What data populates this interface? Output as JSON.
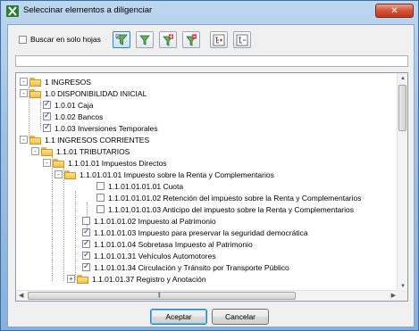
{
  "window": {
    "title": "Seleccinar elementos a diligenciar",
    "close_label": "✕"
  },
  "toolbar": {
    "only_sheets_label": "Buscar en solo hojas",
    "only_sheets_checked": false,
    "buttons": [
      {
        "name": "select-all-filter-icon"
      },
      {
        "name": "filter-icon"
      },
      {
        "name": "add-filter-icon"
      },
      {
        "name": "remove-filter-icon"
      },
      {
        "name": "expand-all-icon"
      },
      {
        "name": "collapse-all-icon"
      }
    ]
  },
  "filter": {
    "value": ""
  },
  "tree": {
    "rows": [
      {
        "label": "1 INGRESOS",
        "level": 0,
        "type": "folder",
        "expander": "-"
      },
      {
        "label": "1.0 DISPONIBILIDAD INICIAL",
        "level": 1,
        "type": "folder",
        "expander": "-"
      },
      {
        "label": "1.0.01 Caja",
        "level": 2,
        "type": "leaf",
        "checked": true
      },
      {
        "label": "1.0.02 Bancos",
        "level": 2,
        "type": "leaf",
        "checked": true
      },
      {
        "label": "1.0.03 Inversiones Temporales",
        "level": 2,
        "type": "leaf",
        "checked": true
      },
      {
        "label": "1.1 INGRESOS CORRIENTES",
        "level": 1,
        "type": "folder",
        "expander": "-"
      },
      {
        "label": "1.1.01 TRIBUTARIOS",
        "level": 2,
        "type": "folder",
        "expander": "-"
      },
      {
        "label": "1.1.01.01 Impuestos Directos",
        "level": 3,
        "type": "folder",
        "expander": "-"
      },
      {
        "label": "1.1.01.01.01 Impuesto sobre la Renta y Complementarios",
        "level": 4,
        "type": "folder",
        "expander": "-"
      },
      {
        "label": "1.1.01.01.01.01 Cuota",
        "level": 5,
        "type": "leaf",
        "checked": false
      },
      {
        "label": "1.1.01.01.01.02 Retención del impuesto sobre la Renta y Complementarios",
        "level": 5,
        "type": "leaf",
        "checked": false
      },
      {
        "label": "1.1.01.01.01.03 Anticipo del impuesto sobre la Renta y Complementarios",
        "level": 5,
        "type": "leaf",
        "checked": false
      },
      {
        "label": "1.1.01.01.02 Impuesto al Patrimonio",
        "level": 4,
        "type": "leaf",
        "checked": false
      },
      {
        "label": "1.1.01.01.03 Impuesto para preservar la seguridad democrática",
        "level": 4,
        "type": "leaf",
        "checked": true
      },
      {
        "label": "1.1.01.01.04 Sobretasa Impuesto al Patrimonio",
        "level": 4,
        "type": "leaf",
        "checked": true
      },
      {
        "label": "1.1.01.01.31 Vehículos Automotores",
        "level": 4,
        "type": "leaf",
        "checked": true
      },
      {
        "label": "1.1.01.01.34 Circulación y Tránsito por Transporte Público",
        "level": 4,
        "type": "leaf",
        "checked": true
      },
      {
        "label": "1.1.01.01.37 Registro y Anotación",
        "level": 4,
        "type": "folder",
        "expander": "+"
      }
    ]
  },
  "footer": {
    "accept_label": "Aceptar",
    "cancel_label": "Cancelar"
  }
}
